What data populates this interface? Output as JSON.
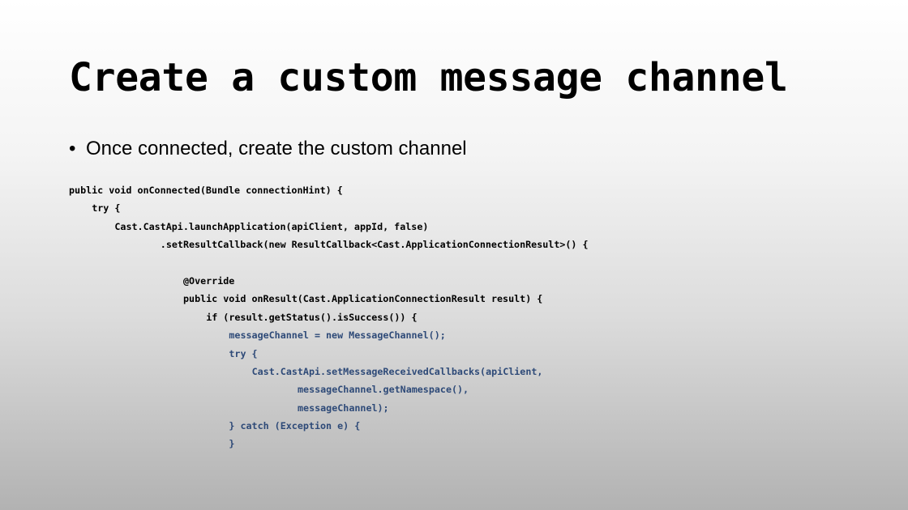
{
  "slide": {
    "title": "Create a custom message channel",
    "bullet_symbol": "•",
    "bullet": "Once connected, create the custom channel",
    "highlight_color": "#2e4a78"
  },
  "code": {
    "lines": [
      {
        "text": "public void onConnected(Bundle connectionHint) {",
        "indent": 0,
        "highlight": false
      },
      {
        "text": "try {",
        "indent": 4,
        "highlight": false
      },
      {
        "text": "Cast.CastApi.launchApplication(apiClient, appId, false)",
        "indent": 8,
        "highlight": false
      },
      {
        "text": ".setResultCallback(new ResultCallback<Cast.ApplicationConnectionResult>() {",
        "indent": 16,
        "highlight": false
      },
      {
        "text": "",
        "indent": 0,
        "highlight": false
      },
      {
        "text": "@Override",
        "indent": 20,
        "highlight": false
      },
      {
        "text": "public void onResult(Cast.ApplicationConnectionResult result) {",
        "indent": 20,
        "highlight": false
      },
      {
        "text": "if (result.getStatus().isSuccess()) {",
        "indent": 24,
        "highlight": false
      },
      {
        "text": "messageChannel = new MessageChannel();",
        "indent": 28,
        "highlight": true
      },
      {
        "text": "try {",
        "indent": 28,
        "highlight": true
      },
      {
        "text": "Cast.CastApi.setMessageReceivedCallbacks(apiClient,",
        "indent": 32,
        "highlight": true
      },
      {
        "text": "messageChannel.getNamespace(),",
        "indent": 40,
        "highlight": true
      },
      {
        "text": "messageChannel);",
        "indent": 40,
        "highlight": true
      },
      {
        "text": "} catch (Exception e) {",
        "indent": 28,
        "highlight": true
      },
      {
        "text": "}",
        "indent": 28,
        "highlight": true
      }
    ]
  }
}
